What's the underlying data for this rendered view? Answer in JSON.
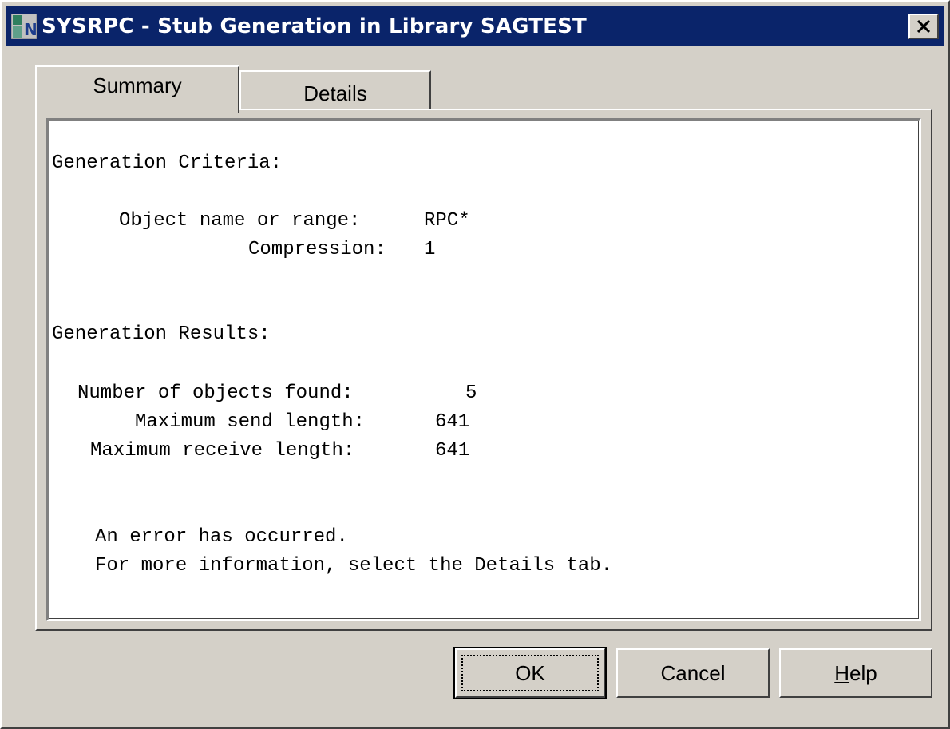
{
  "window": {
    "title": "SYSRPC - Stub Generation in Library SAGTEST",
    "icon": "natural-app-icon",
    "close_icon": "close-icon"
  },
  "tabs": [
    {
      "label": "Summary",
      "active": true
    },
    {
      "label": "Details",
      "active": false
    }
  ],
  "summary": {
    "criteria_heading": "Generation Criteria:",
    "object_name_label": "Object name or range:",
    "object_name_value": "RPC*",
    "compression_label": "Compression:",
    "compression_value": "1",
    "results_heading": "Generation Results:",
    "objects_found_label": "Number of objects found:",
    "objects_found_value": "5",
    "max_send_label": "Maximum send length:",
    "max_send_value": "641",
    "max_receive_label": "Maximum receive length:",
    "max_receive_value": "641",
    "error_line1": "An error has occurred.",
    "error_line2": "For more information, select the Details tab."
  },
  "buttons": {
    "ok": "OK",
    "cancel": "Cancel",
    "help_mnemonic": "H",
    "help_rest": "elp"
  },
  "colors": {
    "titlebar": "#0a246a",
    "face": "#d4d0c8"
  }
}
